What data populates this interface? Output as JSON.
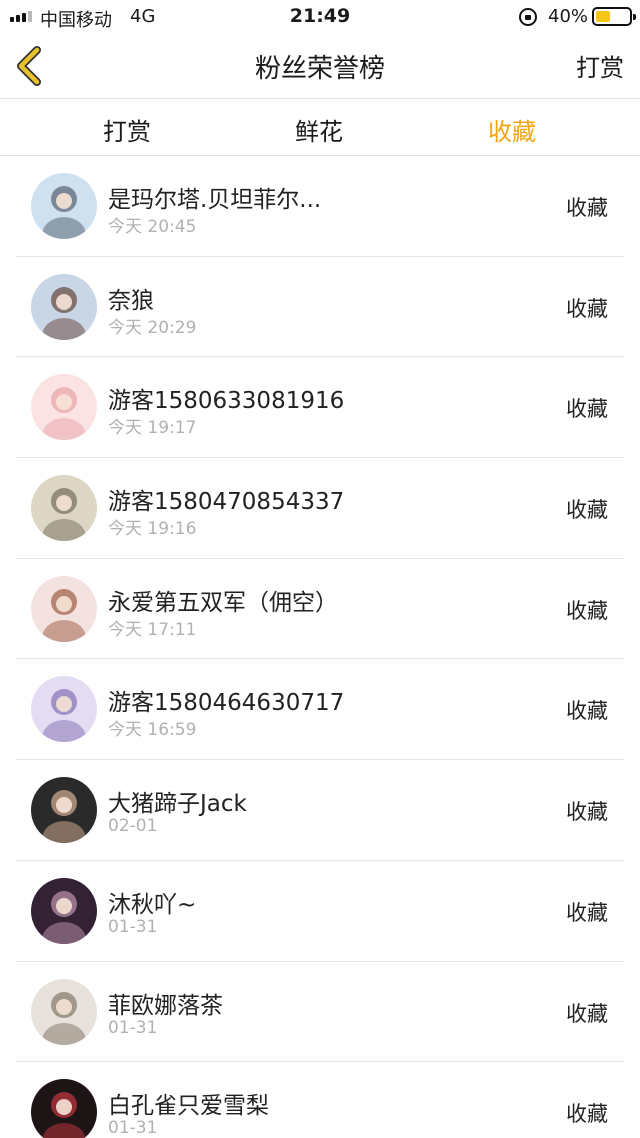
{
  "status_bar": {
    "carrier": "中国移动",
    "network": "4G",
    "time": "21:49",
    "battery_percent": "40%",
    "battery_level": 0.4
  },
  "header": {
    "back_icon": "chevron-left-icon",
    "title": "粉丝荣誉榜",
    "right_action": "打赏"
  },
  "tabs": [
    {
      "label": "打赏",
      "active": false
    },
    {
      "label": "鲜花",
      "active": false
    },
    {
      "label": "收藏",
      "active": true
    }
  ],
  "colors": {
    "accent": "#f0a416",
    "back_icon": "#e8c22c",
    "battery": "#f5c518",
    "secondary_text": "#b1b1b1",
    "divider": "#e6e6e6"
  },
  "fans": [
    {
      "name": "是玛尔塔.贝坦菲尔...",
      "time": "今天 20:45",
      "action": "收藏",
      "avatar": [
        "#cfe0ef",
        "#5d6a78"
      ]
    },
    {
      "name": "奈狼",
      "time": "今天 20:29",
      "action": "收藏",
      "avatar": [
        "#c9d6e6",
        "#6b4f45"
      ]
    },
    {
      "name": "游客1580633081916",
      "time": "今天 19:17",
      "action": "收藏",
      "avatar": [
        "#fbe3e3",
        "#e9a7ae"
      ]
    },
    {
      "name": "游客1580470854337",
      "time": "今天 19:16",
      "action": "收藏",
      "avatar": [
        "#ddd6c4",
        "#7b7466"
      ]
    },
    {
      "name": "永爱第五双军（佣空）",
      "time": "今天 17:11",
      "action": "收藏",
      "avatar": [
        "#f4e2e0",
        "#a4664f"
      ]
    },
    {
      "name": "游客1580464630717",
      "time": "今天 16:59",
      "action": "收藏",
      "avatar": [
        "#e4dcf2",
        "#8b78b8"
      ]
    },
    {
      "name": "大猪蹄子Jack",
      "time": "02-01",
      "action": "收藏",
      "avatar": [
        "#2a2a2a",
        "#c9a58e"
      ]
    },
    {
      "name": "沐秋吖~",
      "time": "01-31",
      "action": "收藏",
      "avatar": [
        "#332233",
        "#b58ea6"
      ]
    },
    {
      "name": "菲欧娜落茶",
      "time": "01-31",
      "action": "收藏",
      "avatar": [
        "#e7e2dc",
        "#8a7d70"
      ]
    },
    {
      "name": "白孔雀只爱雪梨",
      "time": "01-31",
      "action": "收藏",
      "avatar": [
        "#1d1416",
        "#b8343c"
      ]
    }
  ]
}
